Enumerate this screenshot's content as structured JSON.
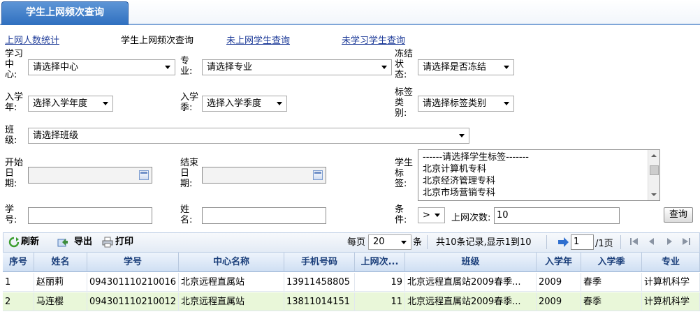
{
  "tab": {
    "title": "学生上网频次查询"
  },
  "nav": {
    "links": [
      "上网人数统计",
      "学生上网频次查询",
      "未上网学生查询",
      "未学习学生查询"
    ]
  },
  "form": {
    "center": {
      "label": "学习中心:",
      "value": "请选择中心"
    },
    "major": {
      "label": "专业:",
      "value": "请选择专业"
    },
    "frozen": {
      "label": "冻结状态:",
      "value": "请选择是否冻结"
    },
    "year": {
      "label": "入学年:",
      "value": "选择入学年度"
    },
    "season": {
      "label": "入学季:",
      "value": "选择入学季度"
    },
    "tagtype": {
      "label": "标签类别:",
      "value": "请选择标签类别"
    },
    "cls": {
      "label": "班级:",
      "value": "请选择班级"
    },
    "start": {
      "label": "开始日期:",
      "value": ""
    },
    "end": {
      "label": "结束日期:",
      "value": ""
    },
    "tags": {
      "label": "学生标签:",
      "options": [
        "------请选择学生标签-------",
        "北京计算机专科",
        "北京经济管理专科",
        "北京市场营销专科"
      ]
    },
    "sid": {
      "label": "学号:",
      "value": ""
    },
    "name": {
      "label": "姓名:",
      "value": ""
    },
    "cond": {
      "label": "条件:",
      "op": ">",
      "count_label": "上网次数:",
      "count_value": "10"
    },
    "query_button": "查询"
  },
  "toolbar": {
    "refresh": "刷新",
    "export": "导出",
    "print": "打印",
    "per_page_label": "每页",
    "per_page_value": "20",
    "per_page_unit": "条",
    "summary": "共10条记录,显示1到10",
    "page_input": "1",
    "page_total": "/1页"
  },
  "grid": {
    "headers": [
      "序号",
      "姓名",
      "学号",
      "中心名称",
      "手机号码",
      "上网次...",
      "班级",
      "入学年",
      "入学季",
      "专业"
    ],
    "rows": [
      [
        "1",
        "赵丽莉",
        "094301110210016",
        "北京远程直属站",
        "13911458805",
        "19",
        "北京远程直属站2009春季...",
        "2009",
        "春季",
        "计算机科学"
      ],
      [
        "2",
        "马连樱",
        "094301110210012",
        "北京远程直属站",
        "13811014151",
        "11",
        "北京远程直属站2009春季...",
        "2009",
        "春季",
        "计算机科学"
      ]
    ]
  },
  "colors": {
    "tab": "#3a7cc8",
    "link": "#1f3c99",
    "row_alt": "#e9f7d9",
    "header_text": "#1a3e7a"
  }
}
